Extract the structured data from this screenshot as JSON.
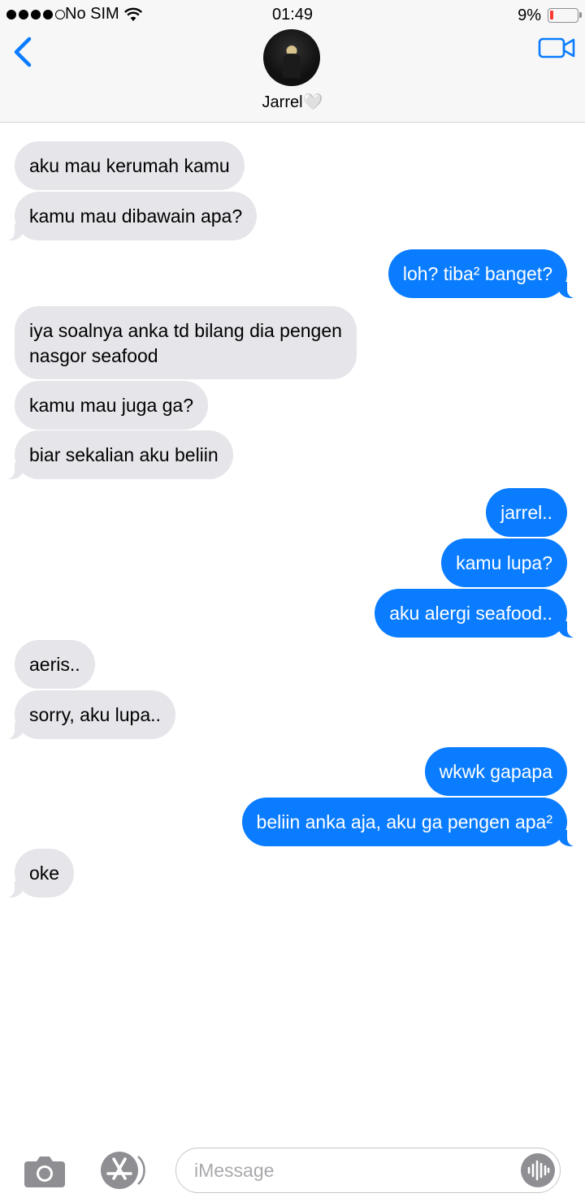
{
  "status_bar": {
    "carrier": "No SIM",
    "time": "01:49",
    "battery_percent": "9%",
    "battery_level": 0.09,
    "battery_color": "#ff3b30",
    "signal_bars": 4
  },
  "header": {
    "contact_name": "Jarrel🤍",
    "back_icon": "chevron-left-icon",
    "video_icon": "video-camera-icon"
  },
  "messages": [
    {
      "from": "contact",
      "text": "aku mau kerumah kamu"
    },
    {
      "from": "contact",
      "text": "kamu mau dibawain apa?"
    },
    {
      "from": "me",
      "text": "loh? tiba² banget?"
    },
    {
      "from": "contact",
      "text": "iya soalnya anka td bilang dia pengen",
      "text2": "nasgor seafood"
    },
    {
      "from": "contact",
      "text": "kamu mau juga ga?"
    },
    {
      "from": "contact",
      "text": "biar sekalian aku beliin"
    },
    {
      "from": "me",
      "text": "jarrel.."
    },
    {
      "from": "me",
      "text": "kamu lupa?"
    },
    {
      "from": "me",
      "text": "aku alergi seafood.."
    },
    {
      "from": "contact",
      "text": "aeris.."
    },
    {
      "from": "contact",
      "text": "sorry, aku lupa.."
    },
    {
      "from": "me",
      "text": "wkwk gapapa"
    },
    {
      "from": "me",
      "text": "beliin anka aja, aku ga pengen apa²"
    },
    {
      "from": "contact",
      "text": "oke"
    }
  ],
  "input_bar": {
    "placeholder": "iMessage",
    "camera_icon": "camera-icon",
    "apps_icon": "app-store-icon",
    "audio_icon": "audio-waveform-icon"
  },
  "colors": {
    "incoming_bubble": "#e5e5ea",
    "outgoing_bubble": "#0a7cff",
    "accent": "#0a7cff"
  }
}
